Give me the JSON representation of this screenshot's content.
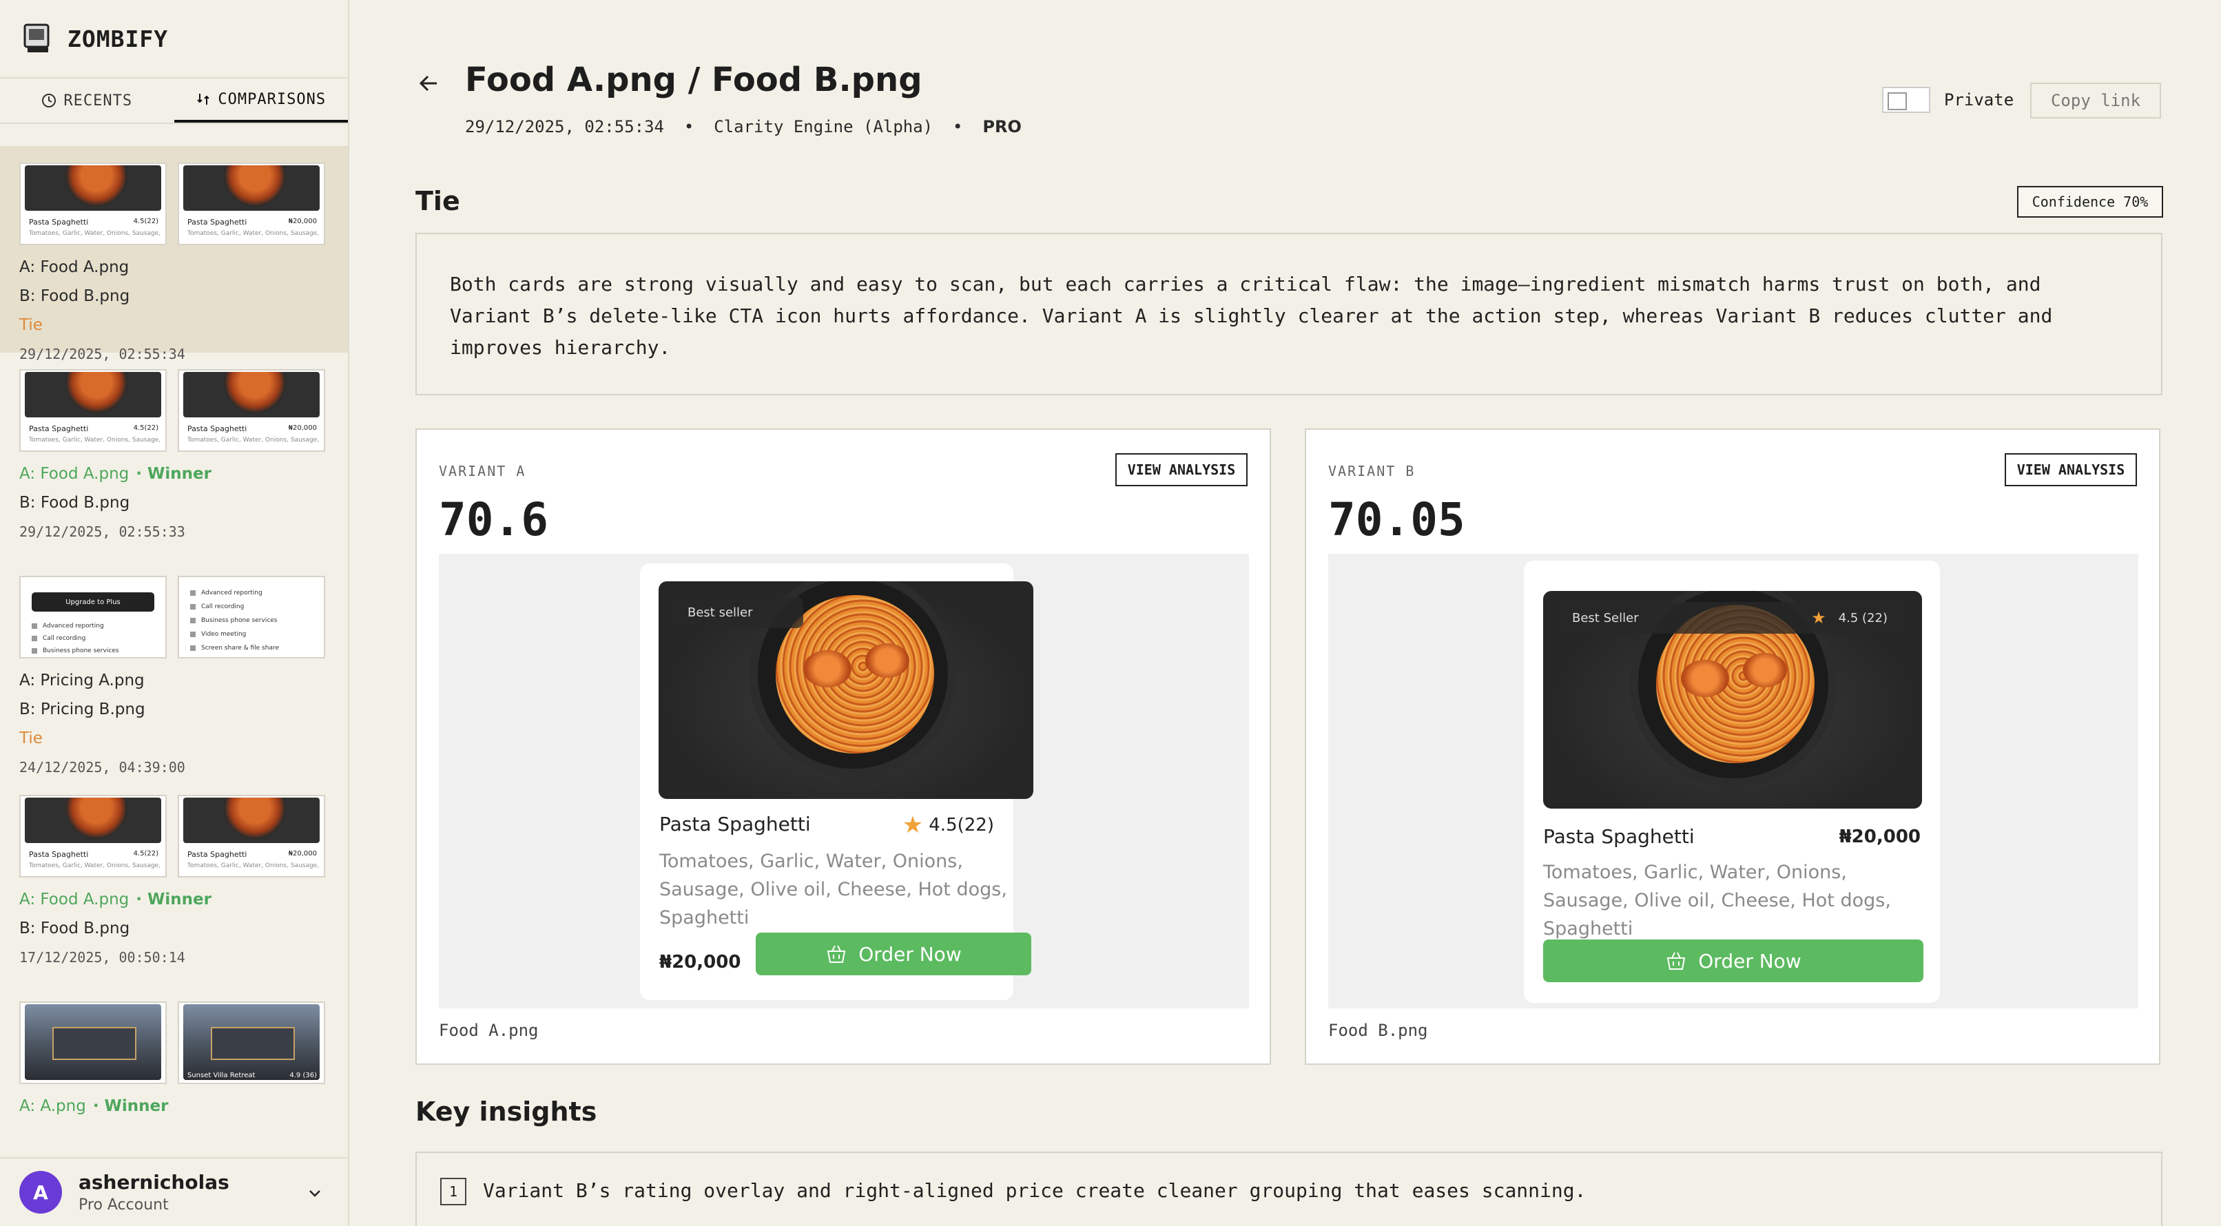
{
  "app": {
    "name": "ZOMBIFY"
  },
  "sidebar": {
    "tabs": [
      {
        "label": "RECENTS"
      },
      {
        "label": "COMPARISONS"
      }
    ],
    "items": [
      {
        "a": "A: Food A.png",
        "b": "B: Food B.png",
        "result": "Tie",
        "date": "29/12/2025, 02:55:34",
        "thumb_a_title": "Pasta Spaghetti",
        "thumb_a_meta": "4.5(22)",
        "thumb_b_title": "Pasta Spaghetti",
        "thumb_b_meta": "₦20,000",
        "thumb_sub": "Tomatoes, Garlic, Water, Onions, Sausage,"
      },
      {
        "a": "A: Food A.png",
        "winner": "· Winner",
        "b": "B: Food B.png",
        "date": "29/12/2025, 02:55:33",
        "thumb_a_title": "Pasta Spaghetti",
        "thumb_a_meta": "4.5(22)",
        "thumb_b_title": "Pasta Spaghetti",
        "thumb_b_meta": "₦20,000",
        "thumb_sub": "Tomatoes, Garlic, Water, Onions, Sausage,"
      },
      {
        "a": "A: Pricing A.png",
        "b": "B: Pricing B.png",
        "result": "Tie",
        "date": "24/12/2025, 04:39:00",
        "thumb_a_btn": "Upgrade to Plus",
        "thumb_a_lines": [
          "Advanced reporting",
          "Call recording",
          "Business phone services"
        ],
        "thumb_b_lines": [
          "Advanced reporting",
          "Call recording",
          "Business phone services",
          "Video meeting",
          "Screen share & file share"
        ]
      },
      {
        "a": "A: Food A.png",
        "winner": "· Winner",
        "b": "B: Food B.png",
        "date": "17/12/2025, 00:50:14",
        "thumb_a_title": "Pasta Spaghetti",
        "thumb_a_meta": "4.5(22)",
        "thumb_b_title": "Pasta Spaghetti",
        "thumb_b_meta": "₦20,000",
        "thumb_sub": "Tomatoes, Garlic, Water, Onions, Sausage,"
      },
      {
        "a": "A: A.png",
        "winner": "· Winner",
        "thumb_b_title": "Sunset Villa Retreat",
        "thumb_b_meta": "4.9 (36)"
      }
    ],
    "user": {
      "initial": "A",
      "name": "ashernicholas",
      "plan": "Pro Account"
    }
  },
  "header": {
    "title": "Food A.png / Food B.png",
    "date": "29/12/2025, 02:55:34",
    "engine": "Clarity Engine (Alpha)",
    "tier": "PRO",
    "sep": "•",
    "private_label": "Private",
    "private_on": false,
    "copy_label": "Copy link"
  },
  "verdict": {
    "result": "Tie",
    "confidence": "Confidence 70%",
    "summary": "Both cards are strong visually and easy to scan, but each carries a critical flaw: the image–ingredient mismatch harms trust on both, and Variant B’s delete-like CTA icon hurts affordance. Variant A is slightly clearer at the action step, whereas Variant B reduces clutter and improves hierarchy."
  },
  "variants": {
    "a": {
      "label": "VARIANT A",
      "button": "VIEW ANALYSIS",
      "score": "70.6",
      "file": "Food A.png",
      "badge": "Best seller",
      "name": "Pasta Spaghetti",
      "rating": "4.5(22)",
      "ingredients": "Tomatoes, Garlic, Water, Onions, Sausage, Olive oil, Cheese, Hot dogs, Spaghetti",
      "price": "₦20,000",
      "cta": "Order Now"
    },
    "b": {
      "label": "VARIANT B",
      "button": "VIEW ANALYSIS",
      "score": "70.05",
      "file": "Food B.png",
      "badge": "Best Seller",
      "name": "Pasta Spaghetti",
      "rating": "4.5 (22)",
      "ingredients": "Tomatoes, Garlic, Water, Onions, Sausage, Olive oil, Cheese, Hot dogs, Spaghetti",
      "price": "₦20,000",
      "cta": "Order Now"
    }
  },
  "insights": {
    "title": "Key insights",
    "items": [
      {
        "num": "1",
        "text": "Variant B’s rating overlay and right-aligned price create cleaner grouping that eases scanning."
      }
    ]
  },
  "colors": {
    "accent_green": "#5cba60",
    "winner_green": "#4ea65c",
    "tie_orange": "#dd8a3a",
    "selected_bg": "#e6dfcc",
    "avatar": "#6a3bd6"
  },
  "icons": [
    "computer-logo-icon",
    "clock-icon",
    "compare-icon",
    "back-arrow-icon",
    "star-icon",
    "basket-icon",
    "chevron-down-icon"
  ]
}
